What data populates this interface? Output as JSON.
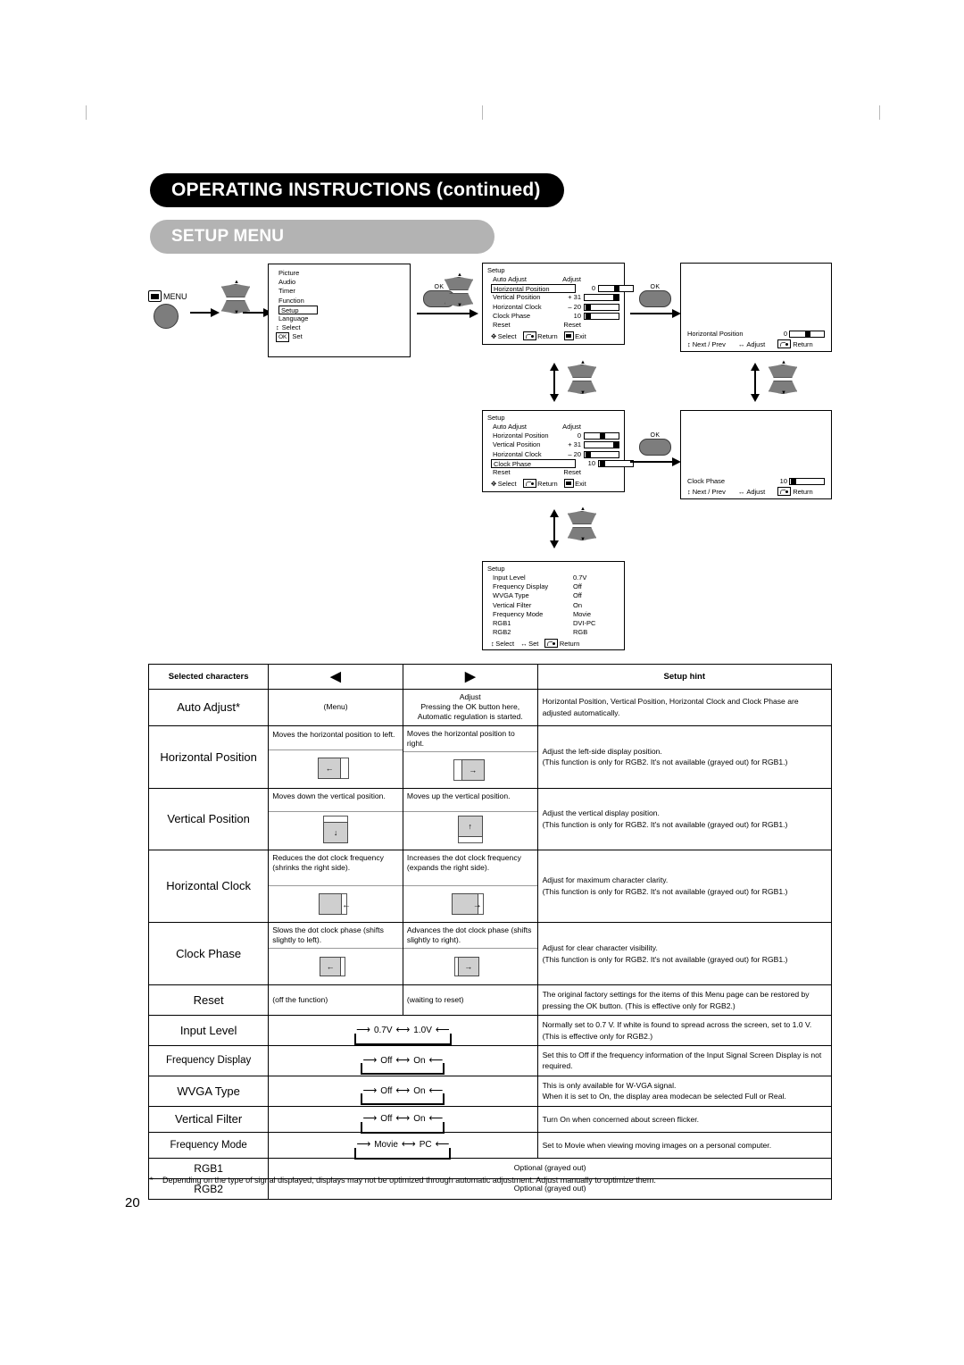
{
  "page": {
    "banner_main": "OPERATING INSTRUCTIONS (continued)",
    "banner_sub": "SETUP MENU",
    "page_number": "20",
    "footnote_marker": "*",
    "footnote": "Depending on the type of signal displayed, displays may not be optimized through automatic adjustment. Adjust manually to optimize them."
  },
  "diagram": {
    "menu_button_label": "MENU",
    "ok_label": "OK",
    "main_menu": {
      "items": [
        "Picture",
        "Audio",
        "Timer",
        "Function",
        "Setup",
        "Language"
      ],
      "highlighted": "Setup",
      "footer_select": "Select",
      "footer_set_key": "OK",
      "footer_set": "Set"
    },
    "setup_hpos": {
      "title": "Setup",
      "adjust_header": "Adjust",
      "rows": [
        {
          "label": "Auto Adjust",
          "value": "Adjust",
          "bar": null,
          "highlighted": false
        },
        {
          "label": "Horizontal Position",
          "value": "0",
          "bar": 45,
          "highlighted": true
        },
        {
          "label": "Vertical Position",
          "value": "+ 31",
          "bar": 90,
          "highlighted": false
        },
        {
          "label": "Horizontal Clock",
          "value": "– 20",
          "bar": 12,
          "highlighted": false
        },
        {
          "label": "Clock Phase",
          "value": "10",
          "bar": 15,
          "highlighted": false
        },
        {
          "label": "Reset",
          "value": "Reset",
          "bar": null,
          "highlighted": false
        }
      ],
      "foot_select": "Select",
      "foot_return": "Return",
      "foot_exit": "Exit"
    },
    "setup_phase": {
      "title": "Setup",
      "adjust_header": "Adjust",
      "rows": [
        {
          "label": "Auto Adjust",
          "value": "Adjust",
          "bar": null,
          "highlighted": false
        },
        {
          "label": "Horizontal Position",
          "value": "0",
          "bar": 45,
          "highlighted": false
        },
        {
          "label": "Vertical Position",
          "value": "+ 31",
          "bar": 90,
          "highlighted": false
        },
        {
          "label": "Horizontal Clock",
          "value": "– 20",
          "bar": 12,
          "highlighted": false
        },
        {
          "label": "Clock Phase",
          "value": "10",
          "bar": 15,
          "highlighted": true
        },
        {
          "label": "Reset",
          "value": "Reset",
          "bar": null,
          "highlighted": false
        }
      ],
      "foot_select": "Select",
      "foot_return": "Return",
      "foot_exit": "Exit"
    },
    "setup_page2": {
      "title": "Setup",
      "rows": [
        {
          "label": "Input Level",
          "value": "0.7V"
        },
        {
          "label": "Frequency Display",
          "value": "Off"
        },
        {
          "label": "WVGA Type",
          "value": "Off"
        },
        {
          "label": "Vertical Filter",
          "value": "On"
        },
        {
          "label": "Frequency Mode",
          "value": "Movie"
        },
        {
          "label": "RGB1",
          "value": "DVI-PC"
        },
        {
          "label": "RGB2",
          "value": "RGB"
        }
      ],
      "foot_select": "Select",
      "foot_set": "Set",
      "foot_return": "Return"
    },
    "preview_hpos": {
      "label": "Horizontal Position",
      "value": "0",
      "bar": 45,
      "foot_nextprev": "Next / Prev",
      "foot_adjust": "Adjust",
      "foot_return": "Return"
    },
    "preview_phase": {
      "label": "Clock Phase",
      "value": "10",
      "bar": 15,
      "foot_nextprev": "Next / Prev",
      "foot_adjust": "Adjust",
      "foot_return": "Return"
    }
  },
  "table": {
    "headers": {
      "col1": "Selected characters",
      "col2": "◀",
      "col3": "▶",
      "col4": "Setup hint"
    },
    "rows": [
      {
        "name": "Auto Adjust*",
        "kind": "plain",
        "left": "(Menu)",
        "right": "Adjust\nPressing the OK button here,\nAutomatic regulation is started.",
        "hint": "Horizontal Position, Vertical Position, Horizontal Clock and Clock Phase are adjusted automatically."
      },
      {
        "name": "Horizontal Position",
        "kind": "split",
        "left": "Moves the horizontal position to left.",
        "right": "Moves the horizontal position to right.",
        "left_pic": "screen-shift-left",
        "right_pic": "screen-shift-right",
        "hint": "Adjust the left-side display position.\n(This function is only for RGB2. It's not available (grayed out) for RGB1.)"
      },
      {
        "name": "Vertical Position",
        "kind": "split",
        "left": "Moves down the vertical position.",
        "right": "Moves up the vertical position.",
        "left_pic": "screen-shift-down",
        "right_pic": "screen-shift-up",
        "hint": "Adjust the vertical display position.\n(This function is only for RGB2. It's not available (grayed out) for RGB1.)"
      },
      {
        "name": "Horizontal Clock",
        "kind": "split",
        "left": "Reduces the dot clock frequency (shrinks the right side).",
        "right": "Increases the dot clock frequency (expands the right side).",
        "left_pic": "screen-shrink-right",
        "right_pic": "screen-expand-right",
        "hint": "Adjust for maximum character clarity.\n(This function is only for RGB2. It's not available (grayed out) for RGB1.)"
      },
      {
        "name": "Clock Phase",
        "kind": "split",
        "left": "Slows the dot clock phase (shifts slightly to left).",
        "right": "Advances the dot clock phase (shifts slightly to right).",
        "left_pic": "screen-phase-left",
        "right_pic": "screen-phase-right",
        "hint": "Adjust for clear character visibility.\n(This function is only for RGB2. It's not available (grayed out) for RGB1.)"
      },
      {
        "name": "Reset",
        "kind": "plain",
        "left": "(off the function)",
        "right": "(waiting to reset)",
        "hint": "The original factory settings for the items of this Menu page can be restored by pressing the OK button. (This is effective only for RGB2.)"
      },
      {
        "name": "Input Level",
        "kind": "loop",
        "loop": [
          "0.7V",
          "1.0V"
        ],
        "hint": "Normally set to 0.7 V. If white is found to spread across the screen, set to 1.0 V. (This is effective only for RGB2.)"
      },
      {
        "name": "Frequency Display",
        "kind": "loop",
        "loop": [
          "Off",
          "On"
        ],
        "hint": "Set this to Off if the frequency information of the Input Signal Screen Display is not required."
      },
      {
        "name": "WVGA Type",
        "kind": "loop",
        "loop": [
          "Off",
          "On"
        ],
        "hint": "This is only available for W-VGA signal.\nWhen it is set to On, the display area modecan be selected Full or Real."
      },
      {
        "name": "Vertical Filter",
        "kind": "loop",
        "loop": [
          "Off",
          "On"
        ],
        "hint": "Turn On when concerned about screen flicker."
      },
      {
        "name": "Frequency Mode",
        "kind": "loop",
        "loop": [
          "Movie",
          "PC"
        ],
        "hint": "Set to Movie when viewing moving images on a personal computer."
      },
      {
        "name": "RGB1",
        "kind": "span",
        "span_text": "Optional (grayed out)"
      },
      {
        "name": "RGB2",
        "kind": "span",
        "span_text": "Optional (grayed out)"
      }
    ]
  },
  "colors": {
    "banner_main_bg": "#000000",
    "banner_sub_bg": "#b3b3b3",
    "button_gray": "#7d7d7d",
    "pictogram_gray": "#cfcfcf"
  }
}
